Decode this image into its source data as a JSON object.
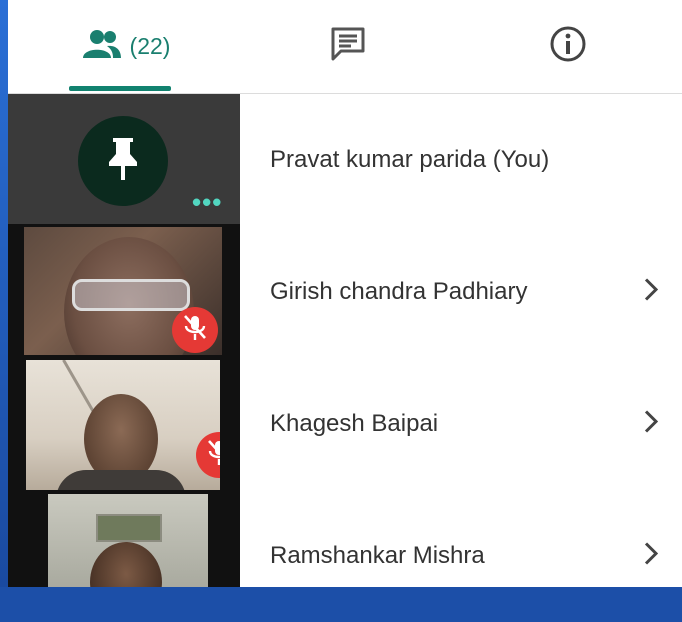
{
  "tabs": {
    "people_count": "(22)",
    "active": "people"
  },
  "pinned": {
    "icon": "pin-icon",
    "more_icon": "more-dots-icon"
  },
  "participants": [
    {
      "name": "Pravat kumar parida (You)",
      "has_chevron": false
    },
    {
      "name": "Girish chandra Padhiary",
      "has_chevron": true
    },
    {
      "name": "Khagesh Baipai",
      "has_chevron": true
    },
    {
      "name": "Ramshankar Mishra",
      "has_chevron": true
    }
  ],
  "colors": {
    "accent": "#1a7f6f",
    "mute_badge": "#e53935",
    "pinned_bg": "#3a3a3a"
  }
}
